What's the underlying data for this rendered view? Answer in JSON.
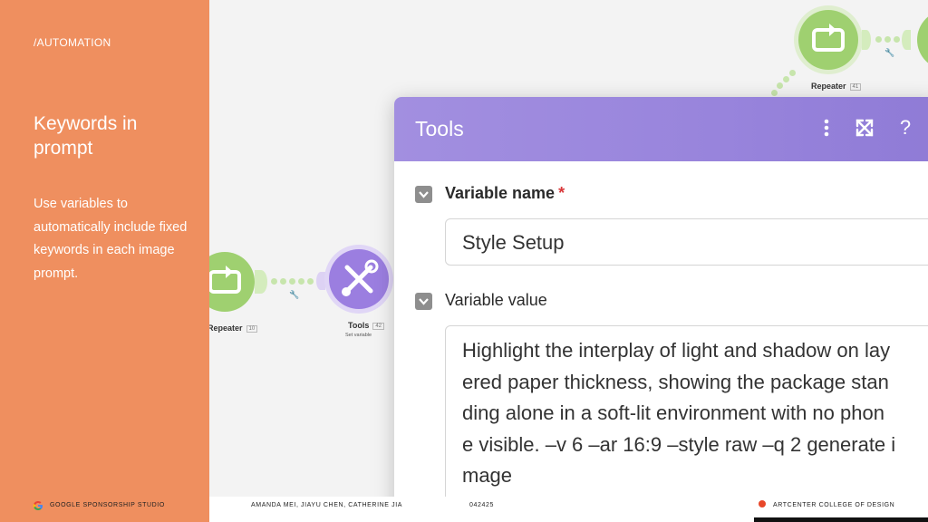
{
  "sidebar": {
    "section_label": "/AUTOMATION",
    "title": "Keywords in prompt",
    "body": "Use variables to automatically include fixed keywords in each image prompt."
  },
  "scenario": {
    "repeater_left": {
      "label": "Repeater",
      "badge": "10",
      "icon": "repeat-icon"
    },
    "repeater_top": {
      "label": "Repeater",
      "badge": "41",
      "icon": "repeat-icon"
    },
    "tools": {
      "label": "Tools",
      "badge": "42",
      "sub": "Set variable",
      "icon": "wrench-screwdriver-icon"
    }
  },
  "dialog": {
    "title": "Tools",
    "header_icons": [
      "more-vertical-icon",
      "expand-icon",
      "help-icon"
    ],
    "help_glyph": "?",
    "fields": [
      {
        "label": "Variable name",
        "required_mark": "*",
        "value": "Style Setup"
      },
      {
        "label": "Variable value",
        "lines": [
          "Highlight the interplay of light and shadow on lay",
          "ered paper thickness, showing the package stan",
          "ding alone in a soft-lit environment with no phon",
          "e visible. –v 6 –ar 16:9 –style raw –q 2 generate i",
          "mage"
        ]
      }
    ]
  },
  "footer": {
    "studio": "GOOGLE SPONSORSHIP STUDIO",
    "authors": "AMANDA MEI, JIAYU CHEN, CATHERINE JIA",
    "date": "042425",
    "college": "ARTCENTER COLLEGE OF DESIGN"
  },
  "colors": {
    "sidebar": "#ef8f5f",
    "node_green": "#9fd070",
    "node_purple": "#9b7ee0",
    "dialog_header": "#9884dc",
    "required": "#d9383a",
    "college_dot": "#e8472a"
  }
}
